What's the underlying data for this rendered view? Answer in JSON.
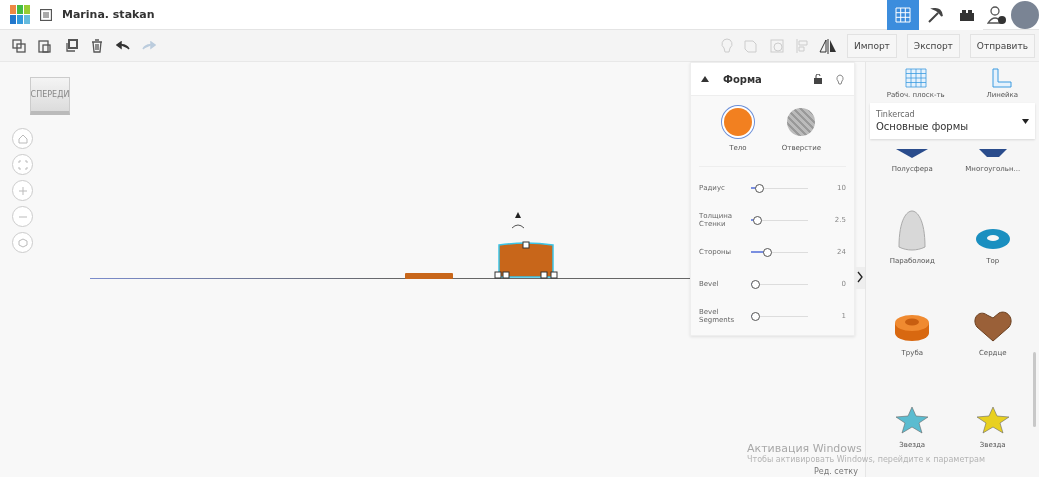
{
  "header": {
    "title": "Marina. stakan",
    "views": [
      {
        "selected": true
      },
      {
        "selected": false
      },
      {
        "selected": false
      }
    ]
  },
  "toolbar": {
    "undo": {
      "disabled": false
    },
    "redo": {
      "disabled": true
    },
    "buttons": [
      "Импорт",
      "Экспорт",
      "Отправить"
    ]
  },
  "canvas": {
    "view_cube": "СПЕРЕДИ",
    "edit_grid": "Ред. сетку"
  },
  "shape_panel": {
    "title": "Форма",
    "modes": [
      {
        "label": "Тело",
        "selected": true
      },
      {
        "label": "Отверстие",
        "selected": false
      }
    ],
    "params": [
      {
        "label": "Радиус",
        "level": 0.08,
        "value": "10"
      },
      {
        "label": "Толщина Стенки",
        "level": 0.04,
        "value": "2.5"
      },
      {
        "label": "Стороны",
        "level": 0.25,
        "value": "24"
      },
      {
        "label": "Bevel",
        "level": 0,
        "value": "0"
      },
      {
        "label": "Bevel Segments",
        "level": 0,
        "value": "1"
      }
    ]
  },
  "sidebar": {
    "tools": [
      "Рабоч. плоск-ть",
      "Линейка"
    ],
    "library": {
      "source": "Tinkercad",
      "name": "Основные формы"
    },
    "shapes": [
      {
        "kind": "halfsphere",
        "label": "Полусфера"
      },
      {
        "kind": "polygon",
        "label": "Многоугольн..."
      },
      {
        "kind": "paraboloid",
        "label": "Параболоид"
      },
      {
        "kind": "torus",
        "label": "Тор"
      },
      {
        "kind": "tube",
        "label": "Труба"
      },
      {
        "kind": "heart",
        "label": "Сердце"
      },
      {
        "kind": "star",
        "label": "Звезда",
        "color": "#5bbcd0"
      },
      {
        "kind": "star",
        "label": "Звезда",
        "color": "#e8d020"
      }
    ]
  },
  "overlay": {
    "title": "Активация Windows",
    "text": "Чтобы активировать Windows, перейдите к параметрам"
  }
}
